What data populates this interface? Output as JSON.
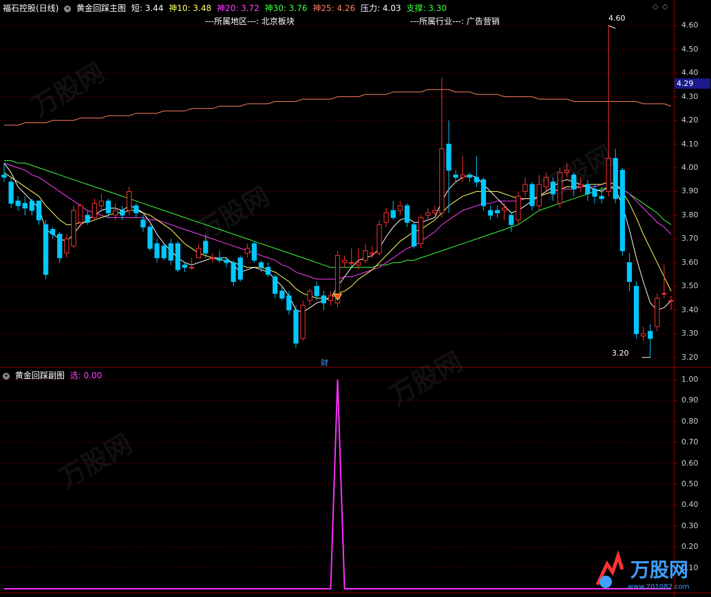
{
  "header": {
    "stock_name": "福石控股(日线)",
    "indicator_name": "黄金回踩主图",
    "short_label": "短: 3.44",
    "ma10_label": "神10: 3.48",
    "ma20_label": "神20: 3.72",
    "ma30_label": "神30: 3.76",
    "ma25_label": "神25: 4.26",
    "resistance_label": "压力: 4.03",
    "support_label": "支撑: 3.30",
    "region_text": "---所属地区---: 北京板块",
    "industry_text": "---所属行业---: 广告营销"
  },
  "sub_header": {
    "indicator_name": "黄金回踩副图",
    "select_label": "选: 0.00"
  },
  "main_axis": [
    "4.60",
    "4.50",
    "4.40",
    "4.30",
    "4.20",
    "4.10",
    "4.00",
    "3.90",
    "3.80",
    "3.70",
    "3.60",
    "3.50",
    "3.40",
    "3.30",
    "3.20"
  ],
  "sub_axis": [
    "1.00",
    "0.90",
    "0.80",
    "0.70",
    "0.60",
    "0.50",
    "0.40",
    "0.30",
    "0.20",
    "0.10"
  ],
  "current_price": "4.29",
  "high_marker": "4.60",
  "low_marker": "3.20",
  "event_marker": "财",
  "watermark_text": "万股网",
  "watermark_url": "www.201082.com",
  "colors": {
    "up": "#ff3232",
    "down": "#00c8ff",
    "ma_short": "#ffffff",
    "ma10": "#ffff64",
    "ma20": "#ff40ff",
    "ma30": "#40ff40",
    "ma_long": "#ff8060",
    "signal": "#ff30ff",
    "grid": "#8c0000"
  },
  "chart_data": {
    "type": "candlestick",
    "price_range": [
      3.17,
      4.65
    ],
    "sub_range": [
      0,
      1
    ],
    "candles": [
      [
        3.97,
        3.96,
        4.02,
        3.94
      ],
      [
        3.94,
        3.85,
        3.96,
        3.83
      ],
      [
        3.86,
        3.84,
        3.88,
        3.82
      ],
      [
        3.85,
        3.83,
        3.88,
        3.8
      ],
      [
        3.86,
        3.82,
        3.87,
        3.8
      ],
      [
        3.86,
        3.78,
        3.86,
        3.76
      ],
      [
        3.76,
        3.55,
        3.78,
        3.53
      ],
      [
        3.74,
        3.72,
        3.75,
        3.7
      ],
      [
        3.72,
        3.62,
        3.73,
        3.6
      ],
      [
        3.64,
        3.7,
        3.72,
        3.62
      ],
      [
        3.67,
        3.82,
        3.84,
        3.66
      ],
      [
        3.77,
        3.84,
        3.85,
        3.75
      ],
      [
        3.8,
        3.77,
        3.82,
        3.76
      ],
      [
        3.79,
        3.85,
        3.87,
        3.78
      ],
      [
        3.84,
        3.86,
        3.89,
        3.82
      ],
      [
        3.86,
        3.81,
        3.87,
        3.79
      ],
      [
        3.8,
        3.82,
        3.85,
        3.78
      ],
      [
        3.82,
        3.8,
        3.84,
        3.78
      ],
      [
        3.82,
        3.9,
        3.92,
        3.8
      ],
      [
        3.84,
        3.81,
        3.85,
        3.79
      ],
      [
        3.78,
        3.75,
        3.8,
        3.73
      ],
      [
        3.75,
        3.66,
        3.76,
        3.65
      ],
      [
        3.68,
        3.62,
        3.7,
        3.6
      ],
      [
        3.67,
        3.62,
        3.68,
        3.61
      ],
      [
        3.68,
        3.61,
        3.7,
        3.59
      ],
      [
        3.68,
        3.57,
        3.69,
        3.56
      ],
      [
        3.59,
        3.58,
        3.6,
        3.56
      ],
      [
        3.58,
        3.58,
        3.62,
        3.57
      ],
      [
        3.62,
        3.66,
        3.68,
        3.62
      ],
      [
        3.69,
        3.64,
        3.72,
        3.62
      ],
      [
        3.62,
        3.62,
        3.64,
        3.6
      ],
      [
        3.62,
        3.61,
        3.65,
        3.6
      ],
      [
        3.61,
        3.6,
        3.62,
        3.58
      ],
      [
        3.6,
        3.52,
        3.61,
        3.5
      ],
      [
        3.62,
        3.53,
        3.63,
        3.52
      ],
      [
        3.64,
        3.66,
        3.68,
        3.62
      ],
      [
        3.68,
        3.61,
        3.69,
        3.6
      ],
      [
        3.6,
        3.58,
        3.61,
        3.56
      ],
      [
        3.58,
        3.55,
        3.6,
        3.54
      ],
      [
        3.54,
        3.47,
        3.55,
        3.45
      ],
      [
        3.48,
        3.45,
        3.5,
        3.44
      ],
      [
        3.46,
        3.4,
        3.48,
        3.38
      ],
      [
        3.4,
        3.26,
        3.42,
        3.24
      ],
      [
        3.28,
        3.42,
        3.44,
        3.27
      ],
      [
        3.44,
        3.48,
        3.49,
        3.42
      ],
      [
        3.5,
        3.46,
        3.52,
        3.44
      ],
      [
        3.46,
        3.43,
        3.48,
        3.4
      ],
      [
        3.44,
        3.46,
        3.48,
        3.42
      ],
      [
        3.43,
        3.63,
        3.65,
        3.41
      ],
      [
        3.6,
        3.61,
        3.63,
        3.58
      ],
      [
        3.6,
        3.6,
        3.66,
        3.58
      ],
      [
        3.59,
        3.6,
        3.66,
        3.57
      ],
      [
        3.61,
        3.65,
        3.68,
        3.6
      ],
      [
        3.64,
        3.64,
        3.67,
        3.62
      ],
      [
        3.64,
        3.76,
        3.78,
        3.63
      ],
      [
        3.77,
        3.81,
        3.83,
        3.75
      ],
      [
        3.82,
        3.79,
        3.86,
        3.78
      ],
      [
        3.82,
        3.84,
        3.86,
        3.8
      ],
      [
        3.84,
        3.77,
        3.85,
        3.75
      ],
      [
        3.76,
        3.67,
        3.77,
        3.66
      ],
      [
        3.68,
        3.79,
        3.8,
        3.66
      ],
      [
        3.8,
        3.81,
        3.83,
        3.78
      ],
      [
        3.81,
        3.82,
        3.84,
        3.8
      ],
      [
        3.81,
        4.08,
        4.38,
        3.79
      ],
      [
        4.1,
        3.99,
        4.2,
        3.81
      ],
      [
        3.97,
        3.96,
        3.99,
        3.94
      ],
      [
        3.96,
        3.97,
        4.05,
        3.94
      ],
      [
        3.97,
        3.96,
        3.98,
        3.94
      ],
      [
        3.96,
        3.94,
        4.05,
        3.92
      ],
      [
        3.95,
        3.84,
        3.96,
        3.82
      ],
      [
        3.82,
        3.8,
        3.84,
        3.78
      ],
      [
        3.82,
        3.81,
        3.84,
        3.79
      ],
      [
        3.82,
        3.83,
        3.85,
        3.78
      ],
      [
        3.8,
        3.76,
        3.81,
        3.73
      ],
      [
        3.78,
        3.88,
        3.9,
        3.76
      ],
      [
        3.9,
        3.93,
        3.96,
        3.88
      ],
      [
        3.93,
        3.84,
        3.94,
        3.82
      ],
      [
        3.84,
        3.93,
        3.97,
        3.82
      ],
      [
        3.92,
        3.96,
        3.98,
        3.9
      ],
      [
        3.94,
        3.89,
        3.96,
        3.86
      ],
      [
        3.85,
        3.98,
        4.0,
        3.83
      ],
      [
        3.98,
        3.99,
        4.02,
        3.96
      ],
      [
        3.97,
        3.91,
        3.98,
        3.88
      ],
      [
        3.92,
        3.93,
        3.96,
        3.9
      ],
      [
        3.93,
        3.89,
        3.95,
        3.86
      ],
      [
        3.91,
        3.88,
        3.93,
        3.85
      ],
      [
        3.88,
        3.87,
        3.92,
        3.85
      ],
      [
        3.9,
        4.04,
        4.6,
        3.88
      ],
      [
        4.04,
        3.87,
        4.08,
        3.85
      ],
      [
        3.99,
        3.65,
        4.0,
        3.63
      ],
      [
        3.6,
        3.52,
        3.64,
        3.48
      ],
      [
        3.5,
        3.3,
        3.52,
        3.28
      ],
      [
        3.29,
        3.3,
        3.33,
        3.27
      ],
      [
        3.31,
        3.28,
        3.34,
        3.2
      ],
      [
        3.33,
        3.45,
        3.47,
        3.31
      ],
      [
        3.47,
        3.47,
        3.59,
        3.45
      ],
      [
        3.44,
        3.44,
        3.46,
        3.4
      ]
    ],
    "ma_short": [
      4.02,
      3.98,
      3.92,
      3.89,
      3.86,
      3.83,
      3.74,
      3.72,
      3.7,
      3.69,
      3.72,
      3.76,
      3.78,
      3.8,
      3.82,
      3.83,
      3.83,
      3.82,
      3.84,
      3.83,
      3.81,
      3.77,
      3.72,
      3.68,
      3.65,
      3.62,
      3.6,
      3.59,
      3.6,
      3.61,
      3.62,
      3.62,
      3.62,
      3.59,
      3.56,
      3.57,
      3.58,
      3.57,
      3.56,
      3.53,
      3.5,
      3.46,
      3.4,
      3.39,
      3.41,
      3.43,
      3.44,
      3.45,
      3.5,
      3.54,
      3.58,
      3.61,
      3.62,
      3.63,
      3.66,
      3.71,
      3.75,
      3.78,
      3.79,
      3.77,
      3.77,
      3.78,
      3.79,
      3.86,
      3.91,
      3.94,
      3.96,
      3.97,
      3.96,
      3.93,
      3.9,
      3.87,
      3.84,
      3.81,
      3.82,
      3.84,
      3.86,
      3.88,
      3.9,
      3.92,
      3.94,
      3.95,
      3.94,
      3.93,
      3.92,
      3.91,
      3.9,
      3.92,
      3.91,
      3.84,
      3.74,
      3.62,
      3.52,
      3.43,
      3.4,
      3.41,
      3.44
    ],
    "ma10": [
      3.98,
      3.96,
      3.94,
      3.92,
      3.9,
      3.88,
      3.84,
      3.81,
      3.78,
      3.76,
      3.76,
      3.77,
      3.77,
      3.78,
      3.79,
      3.8,
      3.81,
      3.81,
      3.82,
      3.82,
      3.81,
      3.8,
      3.78,
      3.76,
      3.74,
      3.71,
      3.68,
      3.66,
      3.64,
      3.63,
      3.62,
      3.61,
      3.61,
      3.6,
      3.59,
      3.58,
      3.58,
      3.58,
      3.57,
      3.56,
      3.54,
      3.52,
      3.49,
      3.47,
      3.46,
      3.45,
      3.45,
      3.45,
      3.47,
      3.48,
      3.5,
      3.53,
      3.55,
      3.57,
      3.6,
      3.63,
      3.66,
      3.69,
      3.71,
      3.73,
      3.74,
      3.76,
      3.78,
      3.81,
      3.84,
      3.86,
      3.88,
      3.89,
      3.9,
      3.9,
      3.9,
      3.9,
      3.89,
      3.88,
      3.87,
      3.87,
      3.87,
      3.88,
      3.89,
      3.9,
      3.91,
      3.92,
      3.92,
      3.92,
      3.93,
      3.93,
      3.93,
      3.94,
      3.93,
      3.9,
      3.85,
      3.79,
      3.72,
      3.66,
      3.6,
      3.54,
      3.48
    ],
    "ma20": [
      4.02,
      4.01,
      4.0,
      3.99,
      3.97,
      3.96,
      3.94,
      3.92,
      3.9,
      3.88,
      3.86,
      3.84,
      3.82,
      3.81,
      3.8,
      3.79,
      3.79,
      3.79,
      3.79,
      3.79,
      3.79,
      3.78,
      3.78,
      3.77,
      3.76,
      3.75,
      3.74,
      3.73,
      3.72,
      3.71,
      3.7,
      3.69,
      3.68,
      3.67,
      3.66,
      3.65,
      3.64,
      3.63,
      3.62,
      3.61,
      3.59,
      3.58,
      3.56,
      3.55,
      3.54,
      3.53,
      3.53,
      3.53,
      3.53,
      3.54,
      3.54,
      3.55,
      3.56,
      3.57,
      3.58,
      3.6,
      3.62,
      3.64,
      3.66,
      3.67,
      3.69,
      3.71,
      3.73,
      3.76,
      3.78,
      3.8,
      3.82,
      3.83,
      3.84,
      3.85,
      3.85,
      3.86,
      3.86,
      3.86,
      3.86,
      3.87,
      3.87,
      3.88,
      3.89,
      3.9,
      3.91,
      3.91,
      3.91,
      3.92,
      3.92,
      3.92,
      3.93,
      3.94,
      3.93,
      3.91,
      3.89,
      3.86,
      3.83,
      3.8,
      3.77,
      3.75,
      3.72
    ],
    "ma30": [
      4.03,
      4.03,
      4.02,
      4.02,
      4.01,
      4.0,
      3.99,
      3.98,
      3.97,
      3.96,
      3.95,
      3.94,
      3.93,
      3.92,
      3.91,
      3.9,
      3.89,
      3.88,
      3.87,
      3.86,
      3.85,
      3.84,
      3.83,
      3.82,
      3.81,
      3.8,
      3.79,
      3.78,
      3.77,
      3.76,
      3.75,
      3.74,
      3.73,
      3.72,
      3.71,
      3.7,
      3.69,
      3.68,
      3.67,
      3.66,
      3.65,
      3.64,
      3.63,
      3.62,
      3.61,
      3.6,
      3.59,
      3.58,
      3.58,
      3.58,
      3.58,
      3.58,
      3.58,
      3.58,
      3.59,
      3.59,
      3.6,
      3.6,
      3.61,
      3.61,
      3.62,
      3.63,
      3.64,
      3.65,
      3.66,
      3.67,
      3.68,
      3.69,
      3.7,
      3.71,
      3.72,
      3.73,
      3.74,
      3.75,
      3.76,
      3.78,
      3.8,
      3.82,
      3.83,
      3.84,
      3.85,
      3.86,
      3.87,
      3.88,
      3.89,
      3.9,
      3.91,
      3.92,
      3.92,
      3.91,
      3.89,
      3.87,
      3.85,
      3.83,
      3.81,
      3.78,
      3.76
    ],
    "ma_long": [
      4.18,
      4.18,
      4.18,
      4.19,
      4.19,
      4.19,
      4.19,
      4.2,
      4.2,
      4.2,
      4.2,
      4.21,
      4.21,
      4.21,
      4.21,
      4.22,
      4.22,
      4.22,
      4.22,
      4.23,
      4.23,
      4.23,
      4.23,
      4.24,
      4.24,
      4.24,
      4.24,
      4.25,
      4.25,
      4.25,
      4.25,
      4.26,
      4.26,
      4.26,
      4.26,
      4.27,
      4.27,
      4.27,
      4.27,
      4.28,
      4.28,
      4.28,
      4.28,
      4.29,
      4.29,
      4.29,
      4.29,
      4.29,
      4.3,
      4.3,
      4.3,
      4.3,
      4.31,
      4.31,
      4.31,
      4.31,
      4.32,
      4.32,
      4.32,
      4.32,
      4.32,
      4.33,
      4.33,
      4.33,
      4.33,
      4.32,
      4.32,
      4.32,
      4.31,
      4.31,
      4.31,
      4.31,
      4.3,
      4.3,
      4.3,
      4.3,
      4.3,
      4.29,
      4.29,
      4.29,
      4.29,
      4.29,
      4.28,
      4.28,
      4.28,
      4.28,
      4.28,
      4.28,
      4.28,
      4.28,
      4.28,
      4.28,
      4.27,
      4.27,
      4.27,
      4.27,
      4.26
    ],
    "signal_index": 48
  }
}
